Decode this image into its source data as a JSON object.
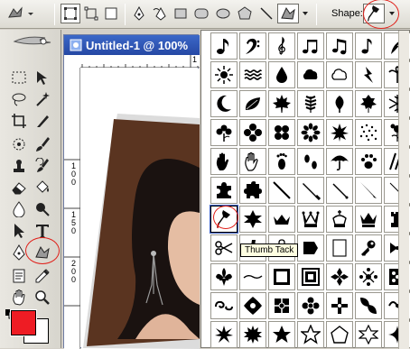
{
  "options_bar": {
    "shape_label": "Shape:",
    "icons": [
      "custom-shape-tool-icon",
      "shape-layers-icon",
      "paths-icon",
      "fill-pixels-icon",
      "pen-icon",
      "freeform-pen-icon",
      "rectangle-icon",
      "rounded-rectangle-icon",
      "ellipse-icon",
      "polygon-icon",
      "line-icon",
      "custom-shape-icon",
      "thumb-tack-shape-icon"
    ]
  },
  "document": {
    "title": "Untitled-1 @ 100%",
    "ruler_top": [
      "1"
    ],
    "ruler_left": [
      "1",
      "0",
      "0",
      "1",
      "5",
      "0",
      "2",
      "0",
      "0"
    ]
  },
  "palette": {
    "tooltip": "Thumb Tack",
    "selected_shape": "thumb-tack"
  },
  "colors": {
    "foreground": "#ee1c24",
    "background": "#ffffff",
    "highlight_circle": "#e0201a"
  }
}
